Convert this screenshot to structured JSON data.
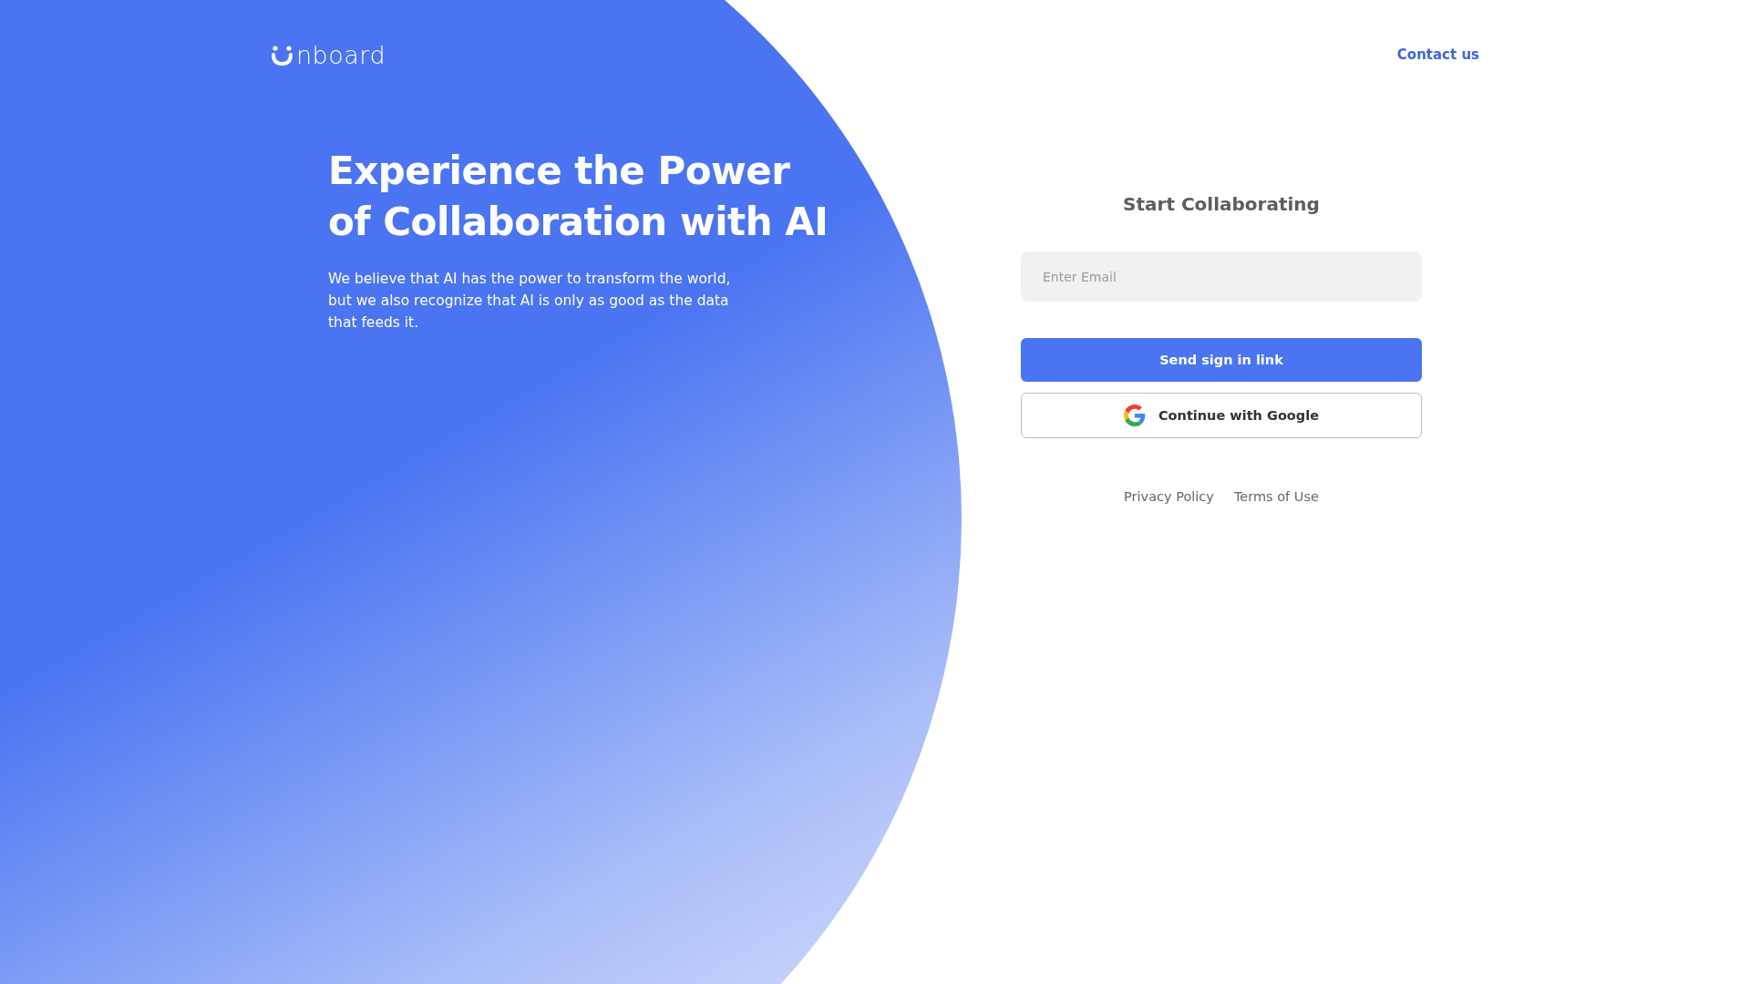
{
  "header": {
    "logo_text": "nboard",
    "contact_link": "Contact us"
  },
  "hero": {
    "headline_lines": [
      "Experience the Power",
      "of Collaboration with AI"
    ],
    "body": "We believe that AI has the power to transform the world, but we also recognize that AI is only as good as the data that feeds it."
  },
  "form": {
    "title": "Start Collaborating",
    "email": {
      "placeholder": "Enter Email"
    },
    "buttons": [
      {
        "kind": "primary",
        "label": "Send sign in link"
      },
      {
        "kind": "google",
        "label": "Continue with Google"
      }
    ],
    "footer_links": [
      "Privacy Policy",
      "Terms of Use"
    ]
  }
}
